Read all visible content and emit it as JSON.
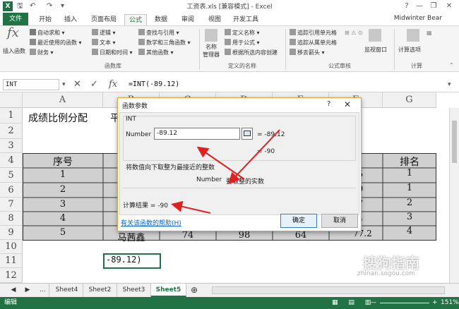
{
  "titlebar": {
    "title": "工资表.xls [兼容模式] - Excel",
    "xl": "X",
    "question": "?",
    "min": "—",
    "restore": "❐",
    "close": "✕"
  },
  "tabs": [
    "文件",
    "开始",
    "插入",
    "页面布局",
    "公式",
    "数据",
    "审阅",
    "视图",
    "开发工具"
  ],
  "user": "Midwinter Bear",
  "ribbon": {
    "insert_function": "插入函数",
    "fx_symbol": "fx",
    "autosum": "自动求和",
    "recent": "最近使用的函数",
    "finance": "财务",
    "logic": "逻辑",
    "text": "文本",
    "datetime": "日期和时间",
    "lookup": "查找与引用",
    "math": "数学和三角函数",
    "more": "其他函数",
    "group_library": "函数库",
    "name_manager": "名称\n管理器",
    "define_name": "定义名称",
    "use_in_formula": "用于公式",
    "create_from_sel": "根据所选内容创建",
    "group_names": "定义的名称",
    "trace_prec": "追踪引用单元格",
    "trace_dep": "追踪从属单元格",
    "remove_arrows": "移去箭头",
    "group_audit": "公式审核",
    "watch": "监视窗口",
    "calc_options": "计算选项",
    "group_calc": "计算"
  },
  "formula_bar": {
    "name": "INT",
    "formula": "=INT(-89.12)",
    "fx": "fx"
  },
  "columns": [
    "A",
    "B",
    "C",
    "D",
    "E",
    "F",
    "G"
  ],
  "rows": [
    "1",
    "2",
    "3",
    "4",
    "5",
    "6",
    "7",
    "8",
    "9",
    "10",
    "11",
    "12"
  ],
  "cells": {
    "b1": "成绩比例分配",
    "c1": "平",
    "a4": "序号",
    "f4": "成绩",
    "g4": "排名",
    "a5": "1",
    "a6": "2",
    "a7": "3",
    "a8": "4",
    "a9": "5",
    "f5": "5",
    "f6": "9",
    "f7": "7",
    "f8": "4",
    "f9": "77.2",
    "g5": "1",
    "g6": "1",
    "g7": "2",
    "g8": "3",
    "g9": "4",
    "b9": "马茜鑫",
    "c9": "74",
    "d9": "98",
    "e9": "64",
    "b11": "-89.12)"
  },
  "sheets": [
    "Sheet4",
    "Sheet2",
    "Sheet3",
    "Sheet5"
  ],
  "sheet_nav": {
    "prev": "◀",
    "next": "▶",
    "more": "..."
  },
  "status": {
    "mode": "编辑",
    "zoom": "151%"
  },
  "dialog": {
    "title": "函数参数",
    "help": "?",
    "close": "✕",
    "func": "INT",
    "arg_label": "Number",
    "arg_value": "-89.12",
    "arg_result": "= -89.12",
    "func_result": "= -90",
    "description": "将数值向下取整为最接近的整数",
    "arg_desc_label": "Number",
    "arg_desc": "要取整的实数",
    "calc_result": "计算结果 = -90",
    "help_link": "有关该函数的帮助(H)",
    "ok": "确定",
    "cancel": "取消"
  },
  "watermark": "搜狗指南",
  "watermark_url": "zhinan.sogou.com"
}
